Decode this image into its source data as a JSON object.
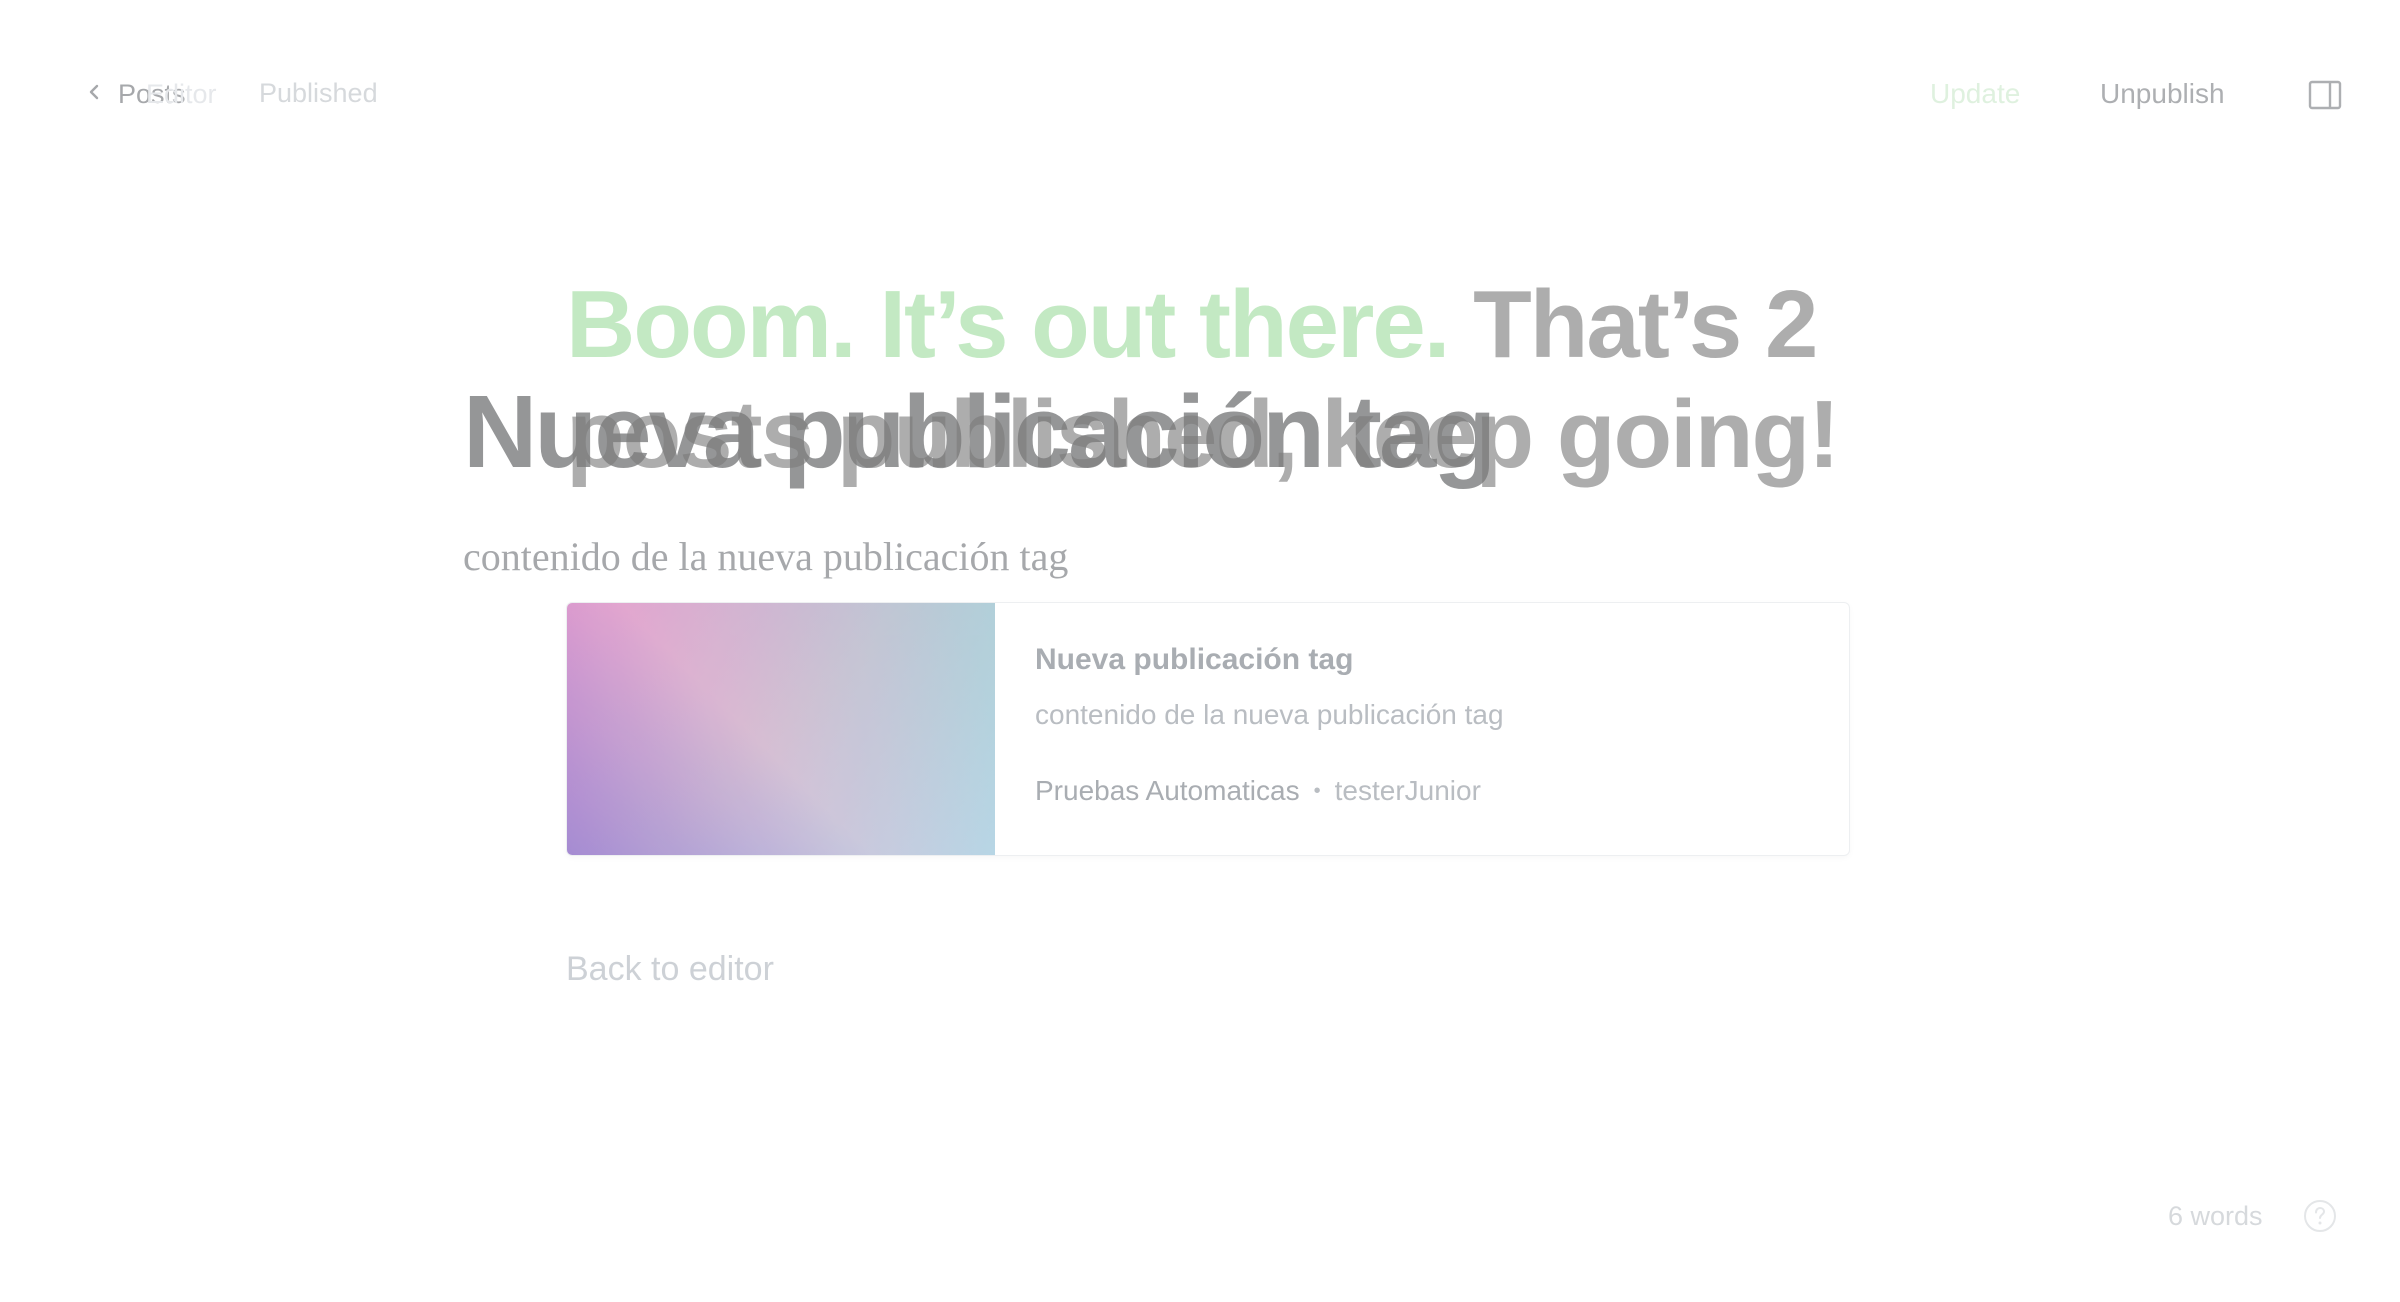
{
  "header": {
    "back_label": "Posts",
    "back_ghost_label": "Editor",
    "status": "Published",
    "update_label": "Update",
    "unpublish_label": "Unpublish"
  },
  "editor": {
    "title": "Nueva publicación tag",
    "body": "contenido de la nueva publicación tag",
    "word_count": "6 words"
  },
  "publish_overlay": {
    "headline_accent": "Boom. It’s out there.",
    "headline_rest": "That’s 2 posts published, keep going!",
    "bookmark": {
      "title": "Nueva publicación tag",
      "excerpt": "contenido de la nueva publicación tag",
      "site": "Pruebas Automaticas",
      "separator": "•",
      "author": "testerJunior"
    },
    "back_to_editor": "Back to editor"
  },
  "colors": {
    "accent_green": "#9edc9e",
    "text_dark": "#15171a",
    "muted": "#a4aab1"
  },
  "icons": [
    "chevron-left-icon",
    "sidebar-panel-icon",
    "help-circle-icon"
  ]
}
